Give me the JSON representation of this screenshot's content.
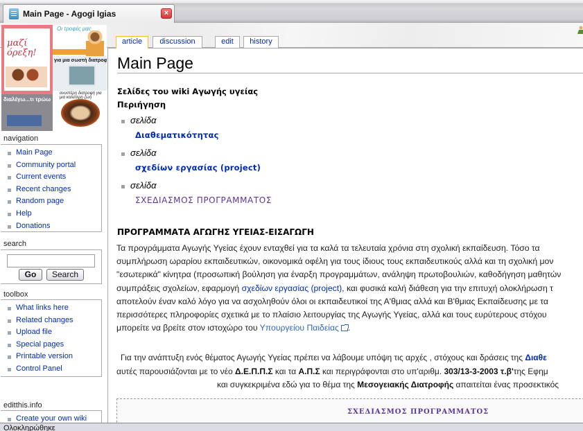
{
  "browser": {
    "tab_title": "Main Page - Agogi Igias",
    "close_symbol": "×",
    "status_text": "Ολοκληρώθηκε"
  },
  "logo": {
    "panel1_text": "μαζί όρεξη!",
    "panel2_text": "Οι τροφές μας",
    "panel3_text": "για μια σωστή διατροφή",
    "panel4_text": "διαλέγω...τι τρώω",
    "panel5_text": "ανυστέρη διατροφή για μια καλύτερη ζωή"
  },
  "content_tabs": [
    {
      "label": "article",
      "selected": true
    },
    {
      "label": "discussion",
      "selected": false
    },
    {
      "label": "edit",
      "selected": false
    },
    {
      "label": "history",
      "selected": false
    }
  ],
  "sidebar": {
    "navigation": {
      "heading": "navigation",
      "items": [
        "Main Page",
        "Community portal",
        "Current events",
        "Recent changes",
        "Random page",
        "Help",
        "Donations"
      ]
    },
    "search": {
      "heading": "search",
      "input_value": "",
      "go_label": "Go",
      "search_label": "Search"
    },
    "toolbox": {
      "heading": "toolbox",
      "items": [
        "What links here",
        "Related changes",
        "Upload file",
        "Special pages",
        "Printable version",
        "Control Panel"
      ]
    },
    "editthis": {
      "heading": "editthis.info",
      "items": [
        "Create your own wiki"
      ]
    }
  },
  "main": {
    "title": "Main Page",
    "subtitle": "Σελίδες του wiki Αγωγής υγείας",
    "nav_heading": "Περιήγηση",
    "pages": [
      {
        "label": "σελίδα",
        "link": "Διαθεματικότητας"
      },
      {
        "label": "σελίδα",
        "link": "σχεδίων εργασίας (project)"
      },
      {
        "label": "σελίδα",
        "link": "ΣΧΕΔΙΑΣΜΟΣ ΠΡΟΓΡΑΜΜΑΤΟΣ"
      }
    ],
    "section_heading": "ΠΡΟΓΡΑΜΜΑΤΑ ΑΓΩΓΗΣ ΥΓΕΙΑΣ-ΕΙΣΑΓΩΓΗ",
    "intro_lines": [
      "Τα προγράμματα Αγωγής Υγείας έχουν ενταχθεί για τα καλά τα τελευταία χρόνια στη σχολική εκπαίδευση. Τόσο τα",
      "συμπλήρωση ωραρίου εκπαιδευτικών, οικονομικά οφέλη για τους ίδιους τους εκπαιδευτικούς αλλά και τη σχολική μον",
      "\"εσωτερικά\" κίνητρα (προσωπική βούληση για έναρξη προγραμμάτων, ανάληψη πρωτοβουλιών, καθοδήγηση μαθητών"
    ],
    "intro_line4_before": "συμπράξεις σχολείων, εφαρμογή ",
    "intro_line4_link": "σχεδίων εργασίας (project)",
    "intro_line4_after": ", και φυσικά καλή διάθεση για την επιτυχή ολοκλήρωση τ",
    "intro_line5": "αποτελούν έναν καλό λόγο για να ασχοληθούν όλοι οι εκπαιδευτικοί της Α'θμιας αλλά και Β'θμιας Εκπαίδευσης με τα",
    "intro_line6": "περισσότερες πληροφορίες σχετικά με το πλαίσιο λειτουργίας της Αγωγής Υγείας, αλλά και τους ευρύτερους στόχου",
    "intro_line7_before": "μπορείτε να βρείτε στον ιστοχώρο του ",
    "intro_line7_link": "Υπουργείου Παιδείας",
    "intro_line7_after": ".",
    "p2_line1_before": "Για την ανάπτυξη ενός θέματος Αγωγής Υγείας πρέπει να λάβουμε υπόψη τις αρχές , στόχους και δράσεις της ",
    "p2_line1_link": "Διαθε",
    "p2_line2_a": "αυτές παρουσιάζονται με το νέο ",
    "p2_line2_b": "Δ.Ε.Π.Π.Σ",
    "p2_line2_c": " και τα ",
    "p2_line2_d": "Α.Π.Σ",
    "p2_line2_e": " και περιγράφονται στο υπ'αριθμ. ",
    "p2_line2_f": "303/13-3-2003 τ.β'",
    "p2_line2_g": "της Εφημ",
    "p2_line3_a": "και συγκεκριμένα εδώ για το θέμα της ",
    "p2_line3_b": "Μεσογειακής Διατροφής",
    "p2_line3_c": " απαιτείται ένας προσεκτικός",
    "box_title": "ΣΧΕΔΙΑΣΜΟΣ ΠΡΟΓΡΑΜΜΑΤΟΣ"
  }
}
